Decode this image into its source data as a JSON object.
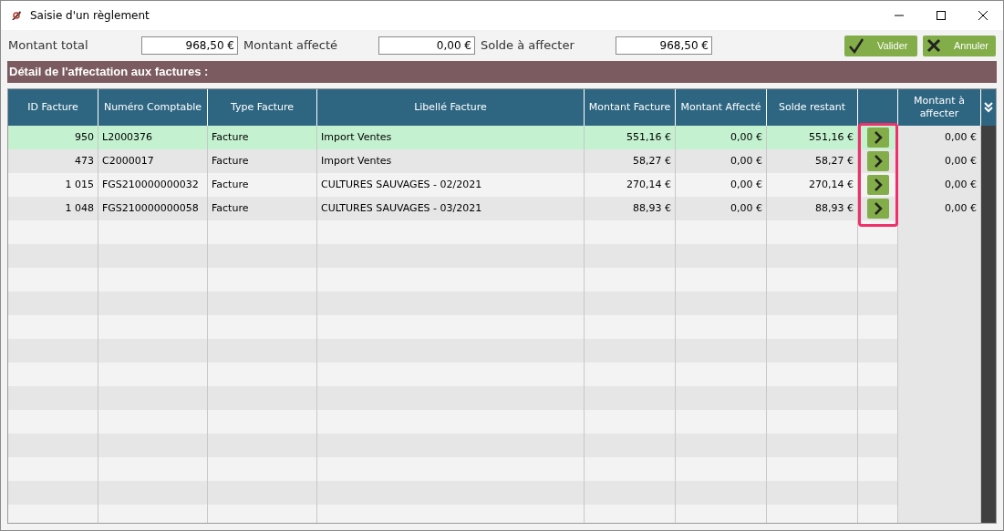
{
  "window": {
    "title": "Saisie d'un règlement"
  },
  "summary": [
    {
      "label": "Montant total",
      "value": "968,50 €"
    },
    {
      "label": "Montant affecté",
      "value": "0,00 €"
    },
    {
      "label": "Solde à affecter",
      "value": "968,50 €"
    }
  ],
  "buttons": [
    {
      "kind": "validate",
      "label": "Valider"
    },
    {
      "kind": "cancel",
      "label": "Annuler"
    }
  ],
  "section_title": "Détail de l'affectation aux factures :",
  "table": {
    "columns": [
      "ID Facture",
      "Numéro Comptable",
      "Type Facture",
      "Libellé Facture",
      "Montant Facture",
      "Montant Affecté",
      "Solde restant",
      "",
      "Montant à affecter"
    ],
    "rows": [
      {
        "selected": true,
        "cells": [
          "950",
          "L2000376",
          "Facture",
          "Import Ventes",
          "551,16 €",
          "0,00 €",
          "551,16 €",
          "0,00 €"
        ]
      },
      {
        "selected": false,
        "cells": [
          "473",
          "C2000017",
          "Facture",
          "Import Ventes",
          "58,27 €",
          "0,00 €",
          "58,27 €",
          "0,00 €"
        ]
      },
      {
        "selected": false,
        "cells": [
          "1 015",
          "FGS210000000032",
          "Facture",
          "CULTURES SAUVAGES - 02/2021",
          "270,14 €",
          "0,00 €",
          "270,14 €",
          "0,00 €"
        ]
      },
      {
        "selected": false,
        "cells": [
          "1 048",
          "FGS210000000058",
          "Facture",
          "CULTURES SAUVAGES - 03/2021",
          "88,93 €",
          "0,00 €",
          "88,93 €",
          "0,00 €"
        ]
      }
    ]
  }
}
